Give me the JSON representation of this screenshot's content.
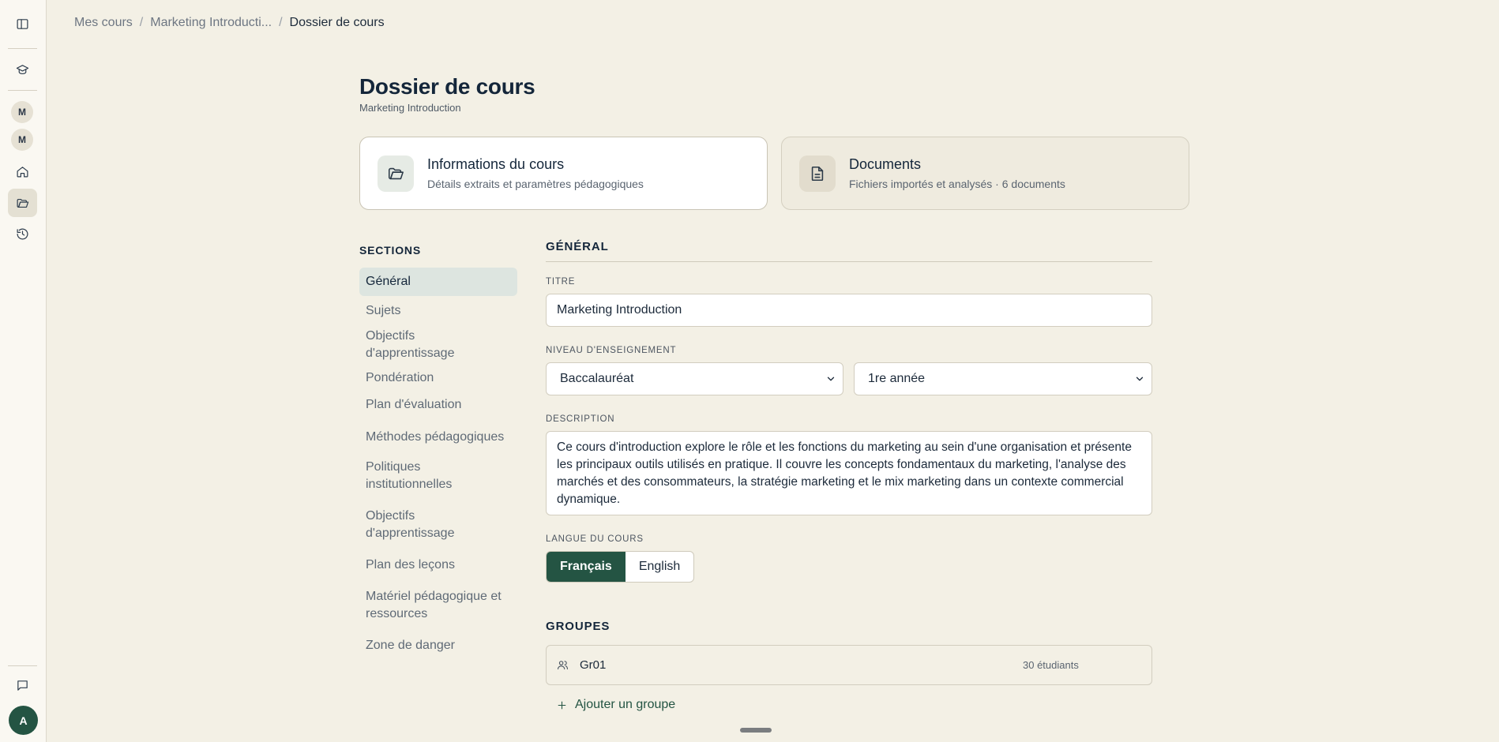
{
  "rail": {
    "icons": [
      "sidebar-toggle-icon",
      "graduation-cap-icon",
      "home-icon",
      "folder-open-icon",
      "history-icon",
      "message-square-icon"
    ],
    "letters": [
      "M",
      "M"
    ],
    "avatar": "A"
  },
  "breadcrumb": {
    "items": [
      "Mes cours",
      "Marketing Introducti...",
      "Dossier de cours"
    ],
    "separator": "/"
  },
  "page": {
    "title": "Dossier de cours",
    "subtitle": "Marketing Introduction"
  },
  "cards": [
    {
      "title": "Informations du cours",
      "subtitle": "Détails extraits et paramètres pédagogiques",
      "icon": "folder-open-icon",
      "active": true
    },
    {
      "title": "Documents",
      "subtitle": "Fichiers importés et analysés · 6 documents",
      "icon": "file-text-icon",
      "active": false
    }
  ],
  "sections": {
    "heading": "SECTIONS",
    "items": [
      "Général",
      "Sujets",
      "Objectifs d'apprentissage",
      "Pondération",
      "Plan d'évaluation",
      "Méthodes pédagogiques",
      "Politiques institutionnelles",
      "Objectifs d'apprentissage",
      "Plan des leçons",
      "Matériel pédagogique et ressources",
      "Zone de danger"
    ],
    "active_index": 0
  },
  "general": {
    "heading": "GÉNÉRAL",
    "title_label": "TITRE",
    "title_value": "Marketing Introduction",
    "level_label": "NIVEAU D'ENSEIGNEMENT",
    "level_value": "Baccalauréat",
    "year_value": "1re année",
    "description_label": "DESCRIPTION",
    "description_value": "Ce cours d'introduction explore le rôle et les fonctions du marketing au sein d'une organisation et présente les principaux outils utilisés en pratique. Il couvre les concepts fondamentaux du marketing, l'analyse des marchés et des consommateurs, la stratégie marketing et le mix marketing dans un contexte commercial dynamique.",
    "language_label": "LANGUE DU COURS",
    "language_options": [
      "Français",
      "English"
    ],
    "language_selected": "Français"
  },
  "groups": {
    "heading": "GROUPES",
    "items": [
      {
        "name": "Gr01",
        "count": "30 étudiants"
      }
    ],
    "add_label": "Ajouter un groupe"
  },
  "colors": {
    "accent": "#245443",
    "background": "#f3f0e5",
    "active_nav": "#dde5e0"
  }
}
